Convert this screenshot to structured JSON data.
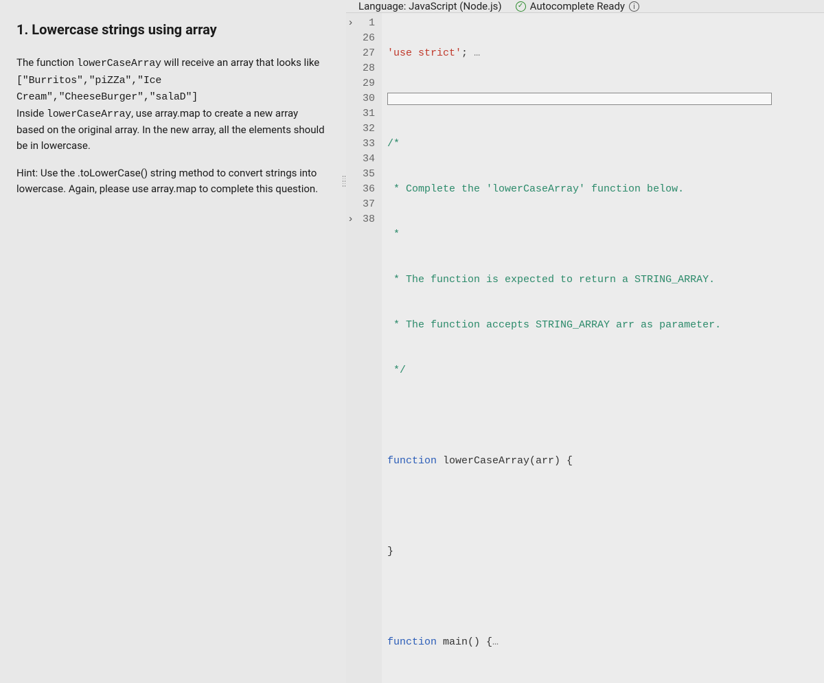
{
  "problem": {
    "title": "1. Lowercase strings using array",
    "p1_a": "The function ",
    "p1_code": "lowerCaseArray",
    "p1_b": " will receive an array that looks like",
    "p2_code": "[\"Burritos\",\"piZZa\",\"Ice Cream\",\"CheeseBurger\",\"salaD\"]",
    "p3_a": "Inside ",
    "p3_code": "lowerCaseArray",
    "p3_b": ", use array.map to create a new array based on the original array. In the new array, all the elements should be in lowercase.",
    "hint": "Hint: Use the .toLowerCase() string method to convert strings into lowercase. Again, please use array.map to complete this question."
  },
  "topbar": {
    "language_label": "Language:",
    "language_value": "JavaScript (Node.js)",
    "autocomplete_label": "Autocomplete Ready"
  },
  "editor": {
    "line_numbers": [
      "1",
      "26",
      "27",
      "28",
      "29",
      "30",
      "31",
      "32",
      "33",
      "34",
      "35",
      "36",
      "37",
      "38"
    ],
    "line1_str": "'use strict'",
    "line1_sem": ";",
    "line1_dots": "…",
    "line27": "/*",
    "line28": " * Complete the 'lowerCaseArray' function below.",
    "line29": " *",
    "line30": " * The function is expected to return a STRING_ARRAY.",
    "line31": " * The function accepts STRING_ARRAY arr as parameter.",
    "line32": " */",
    "line34_kw": "function",
    "line34_rest": " lowerCaseArray(arr) {",
    "line36": "}",
    "line38_kw": "function",
    "line38_rest": " main() {",
    "line38_dots": "…"
  }
}
